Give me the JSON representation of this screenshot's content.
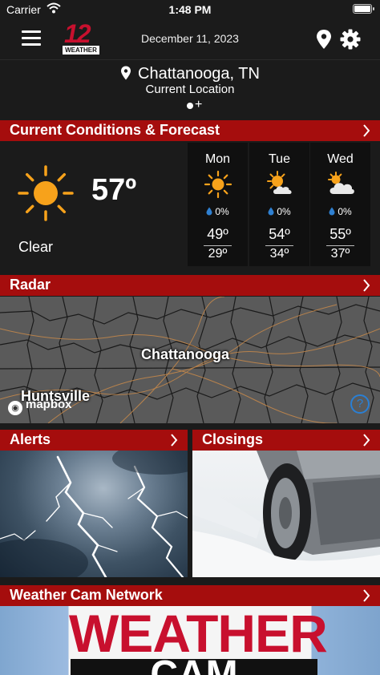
{
  "status_bar": {
    "carrier": "Carrier",
    "time": "1:48 PM"
  },
  "header": {
    "logo_number": "12",
    "logo_word": "WEATHER",
    "date": "December 11, 2023"
  },
  "location": {
    "name": "Chattanooga, TN",
    "subtitle": "Current Location",
    "add_symbol": "+"
  },
  "conditions": {
    "title": "Current Conditions & Forecast",
    "temperature": "57º",
    "description": "Clear",
    "forecast": [
      {
        "day": "Mon",
        "icon": "sun-icon",
        "precip": "0%",
        "high": "49º",
        "low": "29º"
      },
      {
        "day": "Tue",
        "icon": "partly-cloudy-icon",
        "precip": "0%",
        "high": "54º",
        "low": "34º"
      },
      {
        "day": "Wed",
        "icon": "mostly-cloudy-icon",
        "precip": "0%",
        "high": "55º",
        "low": "37º"
      }
    ]
  },
  "radar": {
    "title": "Radar",
    "city_main": "Chattanooga",
    "city_secondary": "Huntsville",
    "attribution": "mapbox",
    "info_symbol": "?"
  },
  "alerts": {
    "title": "Alerts"
  },
  "closings": {
    "title": "Closings"
  },
  "weather_cam": {
    "title": "Weather Cam Network",
    "banner_line1": "WEATHER",
    "banner_line2": "CAM"
  },
  "colors": {
    "accent": "#a50d0d",
    "sun": "#f7a21b",
    "background": "#1b1b1b"
  }
}
